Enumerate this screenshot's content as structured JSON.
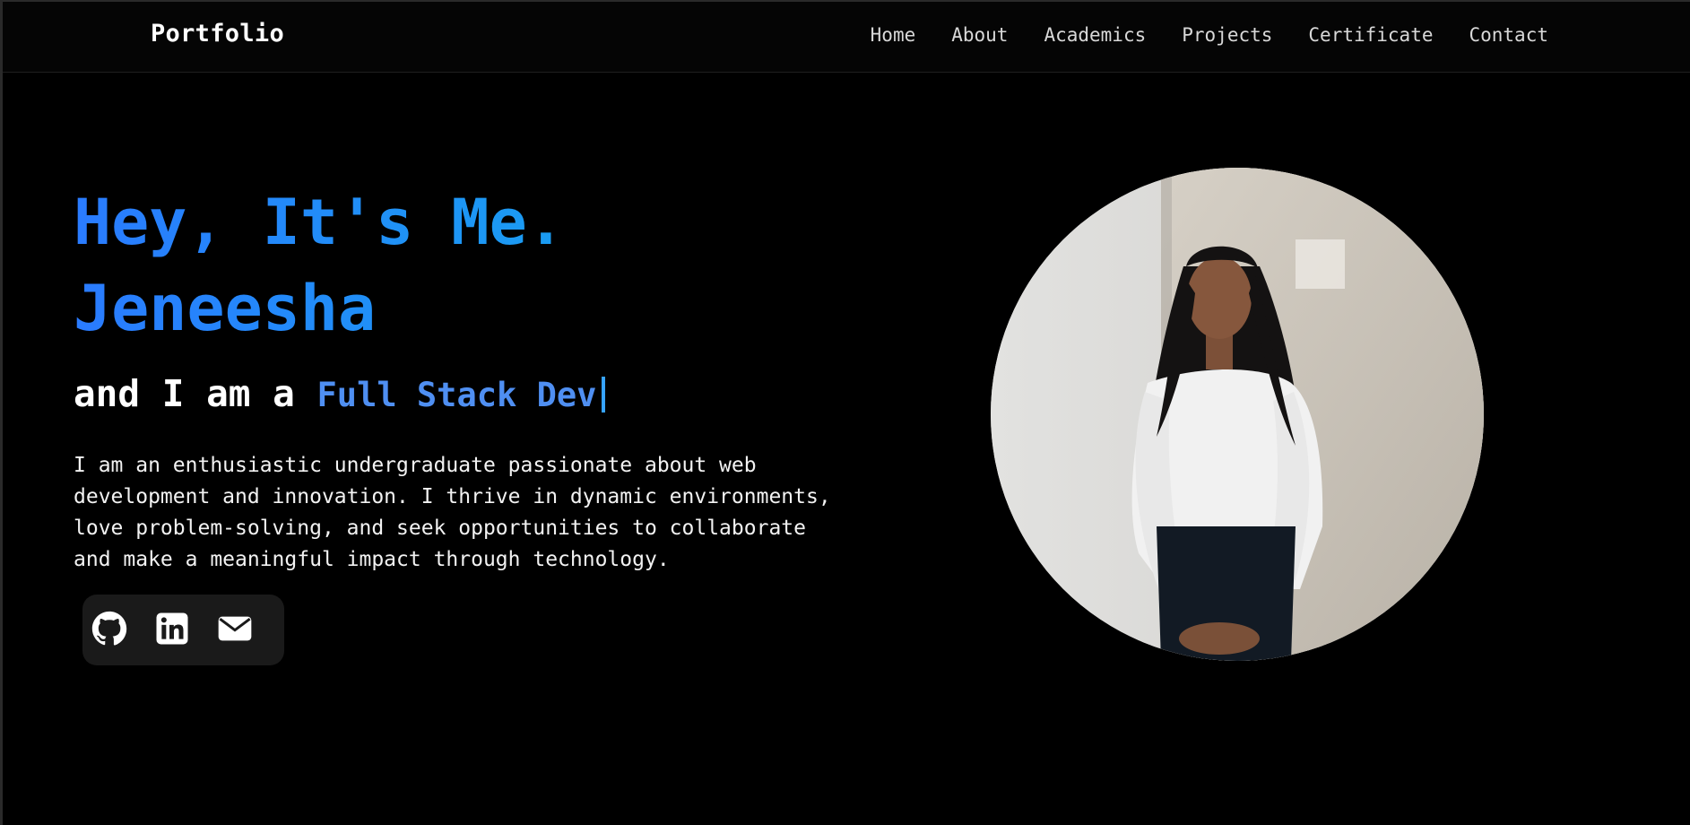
{
  "brand": "Portfolio",
  "nav": {
    "items": [
      {
        "label": "Home"
      },
      {
        "label": "About"
      },
      {
        "label": "Academics"
      },
      {
        "label": "Projects"
      },
      {
        "label": "Certificate"
      },
      {
        "label": "Contact"
      }
    ]
  },
  "hero": {
    "greeting": "Hey, It's Me.",
    "name": "Jeneesha",
    "role_prefix": "and I am a",
    "role_typed": "Full Stack Dev",
    "bio": "I am an enthusiastic undergraduate passionate about web development and innovation. I thrive in dynamic environments, love problem-solving, and seek opportunities to collaborate and make a meaningful impact through technology."
  },
  "socials": [
    {
      "icon": "github-icon"
    },
    {
      "icon": "linkedin-icon"
    },
    {
      "icon": "mail-icon"
    }
  ],
  "colors": {
    "background": "#000000",
    "accent": "#1e90ff",
    "role_text": "#4f8ff2",
    "cursor": "#36a3ff"
  }
}
